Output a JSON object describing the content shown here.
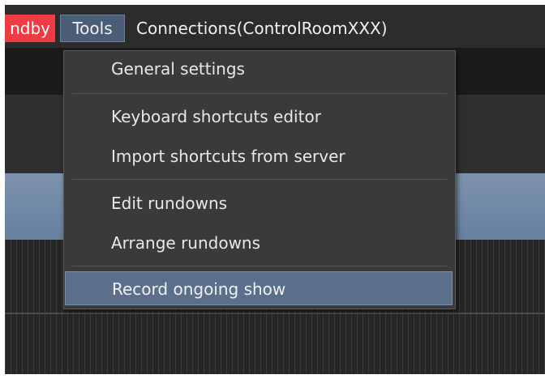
{
  "menubar": {
    "status_badge": "ndby",
    "tools_label": "Tools",
    "connections_label": "Connections(ControlRoomXXX)"
  },
  "tools_menu": {
    "items": [
      {
        "label": "General settings"
      },
      {
        "label": "Keyboard shortcuts editor"
      },
      {
        "label": "Import shortcuts from server"
      },
      {
        "label": "Edit rundowns"
      },
      {
        "label": "Arrange rundowns"
      },
      {
        "label": "Record ongoing show",
        "selected": true
      }
    ]
  },
  "colors": {
    "status_badge": "#ef3b43",
    "menu_highlight": "#5b6f8b",
    "menu_background": "#3a3a3a",
    "app_background": "#2c2c2c"
  }
}
